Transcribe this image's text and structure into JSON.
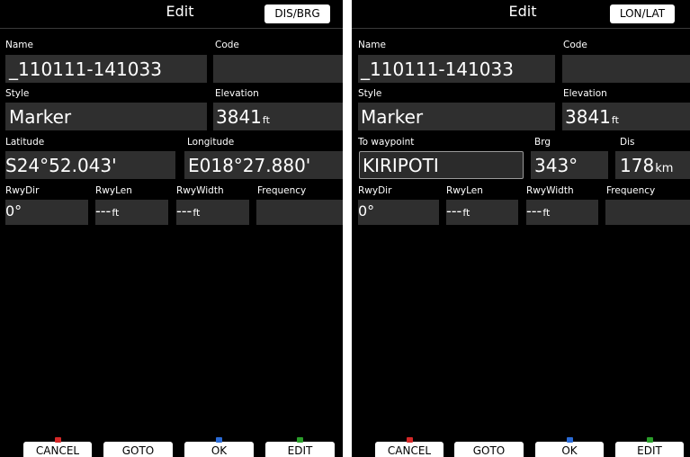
{
  "colors": {
    "cancel_dot": "#d62828",
    "ok_dot": "#2a6bd6",
    "edit_dot": "#2a9d2a"
  },
  "left": {
    "title": "Edit",
    "mode_button": "DIS/BRG",
    "name_label": "Name",
    "name_value": "_110111-141033",
    "code_label": "Code",
    "code_value": "",
    "style_label": "Style",
    "style_value": "Marker",
    "elev_label": "Elevation",
    "elev_value": "3841",
    "elev_unit": "ft",
    "lat_label": "Latitude",
    "lat_value": "S24°52.043'",
    "lon_label": "Longitude",
    "lon_value": "E018°27.880'",
    "rwydir_label": "RwyDir",
    "rwydir_value": "0°",
    "rwylen_label": "RwyLen",
    "rwylen_value": "---",
    "rwylen_unit": "ft",
    "rwywidth_label": "RwyWidth",
    "rwywidth_value": "---",
    "rwywidth_unit": "ft",
    "freq_label": "Frequency",
    "freq_value": "",
    "buttons": {
      "cancel": "CANCEL",
      "goto": "GOTO",
      "ok": "OK",
      "edit": "EDIT"
    }
  },
  "right": {
    "title": "Edit",
    "mode_button": "LON/LAT",
    "name_label": "Name",
    "name_value": "_110111-141033",
    "code_label": "Code",
    "code_value": "",
    "style_label": "Style",
    "style_value": "Marker",
    "elev_label": "Elevation",
    "elev_value": "3841",
    "elev_unit": "ft",
    "towp_label": "To waypoint",
    "towp_value": "KIRIPOTI",
    "brg_label": "Brg",
    "brg_value": "343°",
    "dis_label": "Dis",
    "dis_value": "178",
    "dis_unit": "km",
    "rwydir_label": "RwyDir",
    "rwydir_value": "0°",
    "rwylen_label": "RwyLen",
    "rwylen_value": "---",
    "rwylen_unit": "ft",
    "rwywidth_label": "RwyWidth",
    "rwywidth_value": "---",
    "rwywidth_unit": "ft",
    "freq_label": "Frequency",
    "freq_value": "",
    "buttons": {
      "cancel": "CANCEL",
      "goto": "GOTO",
      "ok": "OK",
      "edit": "EDIT"
    }
  }
}
